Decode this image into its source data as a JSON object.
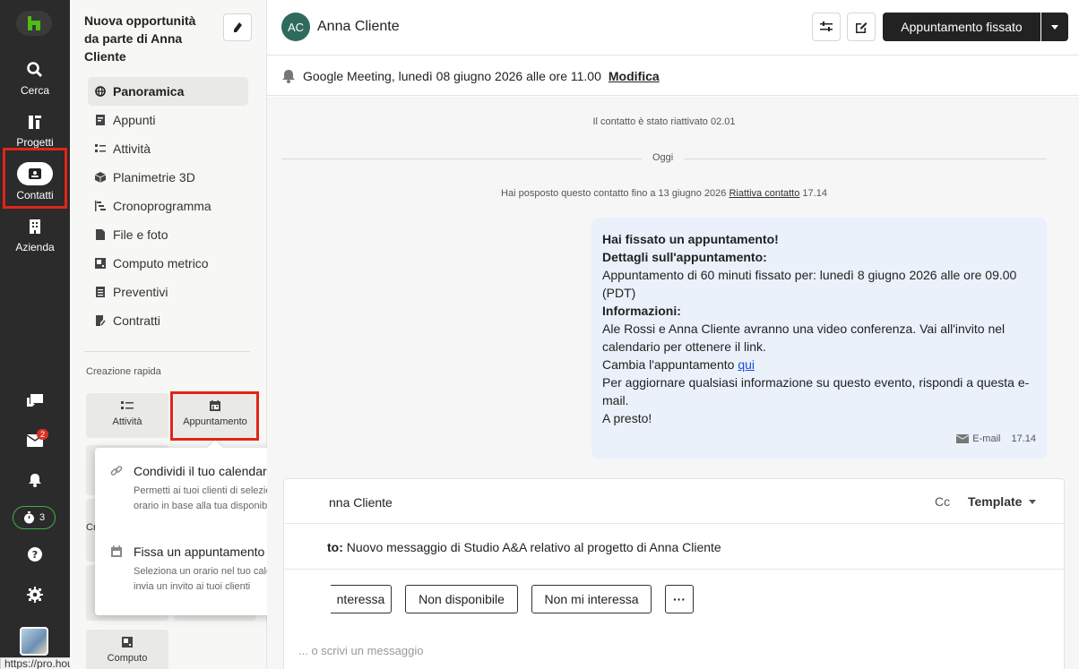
{
  "rail": {
    "items": [
      {
        "label": "Cerca",
        "icon": "search-icon"
      },
      {
        "label": "Progetti",
        "icon": "projects-icon"
      },
      {
        "label": "Contatti",
        "icon": "contacts-icon"
      },
      {
        "label": "Azienda",
        "icon": "building-icon"
      }
    ],
    "inbox_badge": "2",
    "timer_count": "3",
    "status_url": "https://pro.houzz.it"
  },
  "sidebar": {
    "project_title": "Nuova opportunità da parte di Anna Cliente",
    "nav": [
      {
        "label": "Panoramica",
        "icon": "globe-icon",
        "active": true
      },
      {
        "label": "Appunti",
        "icon": "notes-icon"
      },
      {
        "label": "Attività",
        "icon": "tasks-icon"
      },
      {
        "label": "Planimetrie 3D",
        "icon": "cube-icon"
      },
      {
        "label": "Cronoprogramma",
        "icon": "schedule-icon"
      },
      {
        "label": "File e foto",
        "icon": "file-icon"
      },
      {
        "label": "Computo metrico",
        "icon": "estimate-icon"
      },
      {
        "label": "Preventivi",
        "icon": "quote-icon"
      },
      {
        "label": "Contratti",
        "icon": "contract-icon"
      }
    ],
    "quick_create_label": "Creazione rapida",
    "quick": [
      {
        "label": "Attività",
        "icon": "tasks-icon"
      },
      {
        "label": "Appuntamento",
        "icon": "calendar-icon"
      },
      {
        "label": "Computo",
        "icon": "estimate-icon"
      }
    ],
    "partial_label": "Cr"
  },
  "popover": {
    "items": [
      {
        "title": "Condividi il tuo calendario",
        "desc": "Permetti ai tuoi clienti di selezionare un orario in base alla tua disponibilità",
        "icon": "link-icon"
      },
      {
        "title": "Fissa un appuntamento",
        "desc": "Seleziona un orario nel tuo calendario e invia un invito ai tuoi clienti",
        "icon": "calendar-icon"
      }
    ]
  },
  "header": {
    "initials": "AC",
    "name": "Anna Cliente",
    "status_button": "Appuntamento fissato"
  },
  "meeting": {
    "text": "Google Meeting, lunedì 08 giugno 2026 alle ore 11.00",
    "edit_link": "Modifica"
  },
  "conversation": {
    "reactivated": "Il contatto è stato riattivato 02.01",
    "today": "Oggi",
    "postponed_text": "Hai posposto questo contatto fino a 13 giugno 2026",
    "postponed_link": "Riattiva contatto",
    "postponed_time": "17.14",
    "message": {
      "line1": "Hai fissato un appuntamento!",
      "line2": "Dettagli sull'appuntamento:",
      "line3": "Appuntamento di 60 minuti fissato per: lunedì 8 giugno 2026 alle ore 09.00 (PDT)",
      "line4": "Informazioni:",
      "line5": "Ale Rossi e Anna Cliente avranno una video conferenza. Vai all'invito nel calendario per ottenere il link.",
      "line6_prefix": "Cambia l'appuntamento",
      "line6_link": "qui",
      "line7": "Per aggiornare qualsiasi informazione su questo evento, rispondi a questa e-mail.",
      "line8": "A presto!",
      "channel": "E-mail",
      "time": "17.14"
    }
  },
  "composer": {
    "to_name": "nna Cliente",
    "cc": "Cc",
    "template": "Template",
    "subject_label": "to:",
    "subject": "Nuovo messaggio di Studio A&A relativo al progetto di Anna Cliente",
    "chips": [
      "nteressa",
      "Non disponibile",
      "Non mi interessa",
      "···"
    ],
    "placeholder": "... o scrivi un messaggio"
  }
}
